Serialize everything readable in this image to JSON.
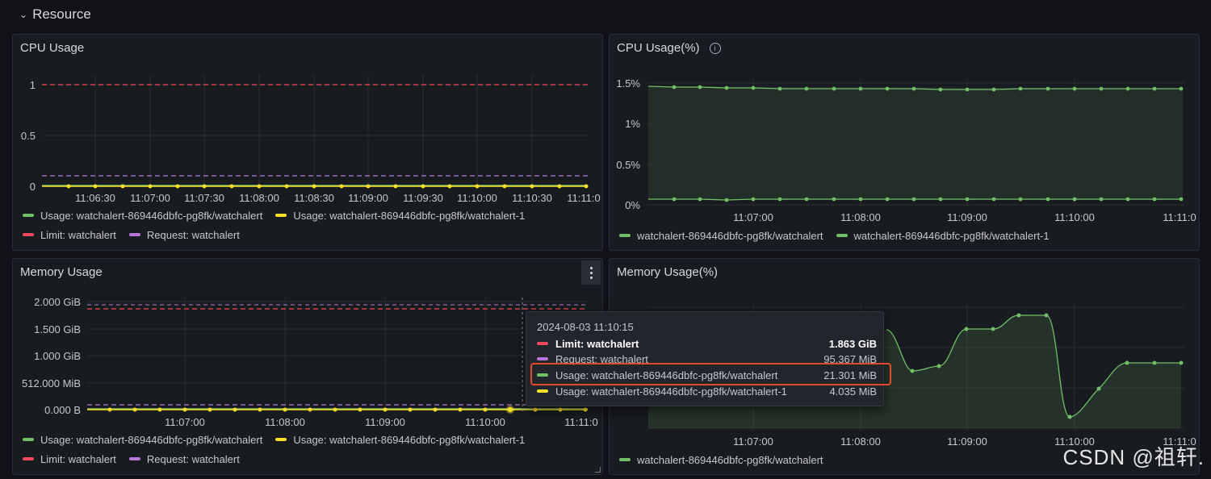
{
  "section": {
    "title": "Resource",
    "chevron_icon": "chevron-down-icon"
  },
  "colors": {
    "green": "#73bf69",
    "yellow": "#fade2a",
    "red": "#f2495c",
    "purple": "#b877d9",
    "highlight": "#e04b2f"
  },
  "panels": {
    "cpu": {
      "title": "CPU Usage",
      "y_ticks": [
        "1",
        "0.5",
        "0"
      ],
      "x_ticks": [
        "11:06:30",
        "11:07:00",
        "11:07:30",
        "11:08:00",
        "11:08:30",
        "11:09:00",
        "11:09:30",
        "11:10:00",
        "11:10:30",
        "11:11:0"
      ],
      "legend": [
        "Usage: watchalert-869446dbfc-pg8fk/watchalert",
        "Usage: watchalert-869446dbfc-pg8fk/watchalert-1",
        "Limit: watchalert",
        "Request: watchalert"
      ]
    },
    "cpu_pct": {
      "title": "CPU Usage(%)",
      "y_ticks": [
        "1.5%",
        "1%",
        "0.5%",
        "0%"
      ],
      "x_ticks": [
        "11:07:00",
        "11:08:00",
        "11:09:00",
        "11:10:00",
        "11:11:0"
      ],
      "legend": [
        "watchalert-869446dbfc-pg8fk/watchalert",
        "watchalert-869446dbfc-pg8fk/watchalert-1"
      ]
    },
    "mem": {
      "title": "Memory Usage",
      "y_ticks": [
        "2.000 GiB",
        "1.500 GiB",
        "1.000 GiB",
        "512.000 MiB",
        "0.000 B"
      ],
      "x_ticks": [
        "11:07:00",
        "11:08:00",
        "11:09:00",
        "11:10:00",
        "11:11:0"
      ],
      "legend": [
        "Usage: watchalert-869446dbfc-pg8fk/watchalert",
        "Usage: watchalert-869446dbfc-pg8fk/watchalert-1",
        "Limit: watchalert",
        "Request: watchalert"
      ]
    },
    "mem_pct": {
      "title": "Memory Usage(%)",
      "x_ticks": [
        "11:07:00",
        "11:08:00",
        "11:09:00",
        "11:10:00",
        "11:11:0"
      ],
      "legend": [
        "watchalert-869446dbfc-pg8fk/watchalert"
      ]
    }
  },
  "tooltip": {
    "time": "2024-08-03 11:10:15",
    "rows": [
      {
        "label": "Limit: watchalert",
        "value": "1.863 GiB"
      },
      {
        "label": "Request: watchalert",
        "value": "95.367 MiB"
      },
      {
        "label": "Usage: watchalert-869446dbfc-pg8fk/watchalert",
        "value": "21.301 MiB"
      },
      {
        "label": "Usage: watchalert-869446dbfc-pg8fk/watchalert-1",
        "value": "4.035 MiB"
      }
    ]
  },
  "watermark": "CSDN @祖轩."
}
